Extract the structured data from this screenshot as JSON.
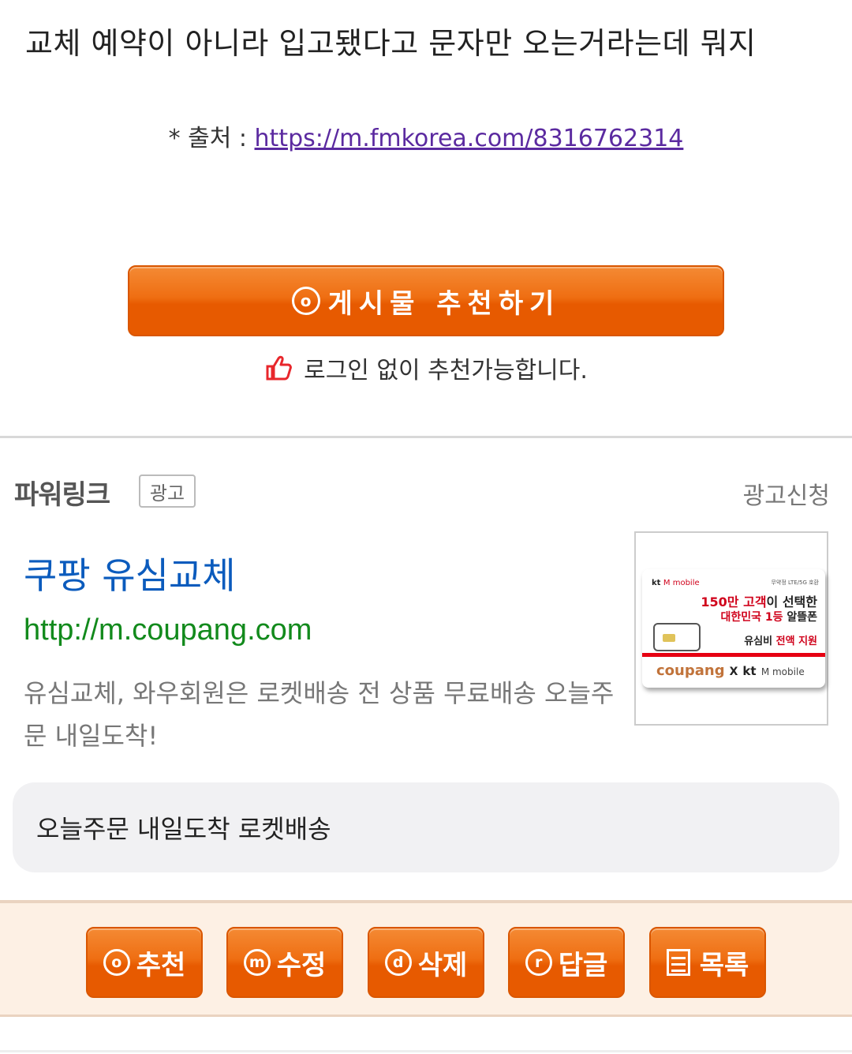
{
  "post": {
    "text": "교체 예약이 아니라 입고됐다고 문자만 오는거라는데 뭐지",
    "source_prefix": "* 출처 : ",
    "source_url": "https://m.fmkorea.com/8316762314"
  },
  "recommend": {
    "glyph": "o",
    "label": "게시물 추천하기",
    "no_login_text": "로그인 없이 추천가능합니다."
  },
  "powerlink": {
    "brand": "파워링크",
    "badge": "광고",
    "apply": "광고신청",
    "ad": {
      "title": "쿠팡 유심교체",
      "url": "http://m.coupang.com",
      "description": "유심교체, 와우회원은 로켓배송 전 상품 무료배송 오늘주문 내일도착!",
      "thumbnail": {
        "brand_kt": "kt",
        "brand_mobile": "M mobile",
        "compat": "무약정 LTE/5G 호환",
        "line1_red": "150만 고객",
        "line1_rest": "이 선택한",
        "line2_red": "대한민국 1등",
        "line2_rest": " 알뜰폰",
        "line3_prefix": "유심비 ",
        "line3_red": "전액 지원",
        "bottom_coupang": "coupang",
        "bottom_x": "X",
        "bottom_kt": "kt",
        "bottom_mobile": "M mobile"
      },
      "sublink": "오늘주문 내일도착 로켓배송"
    }
  },
  "actions": [
    {
      "glyph": "o",
      "label": "추천"
    },
    {
      "glyph": "m",
      "label": "수정"
    },
    {
      "glyph": "d",
      "label": "삭제"
    },
    {
      "glyph": "r",
      "label": "답글"
    },
    {
      "glyph": "list",
      "label": "목록"
    }
  ],
  "colors": {
    "accent_orange": "#e75a00",
    "link_purple": "#5b2aa0",
    "ad_title_blue": "#0b5bbd",
    "ad_url_green": "#128a1c",
    "action_bar_bg": "#fdf0e4"
  }
}
